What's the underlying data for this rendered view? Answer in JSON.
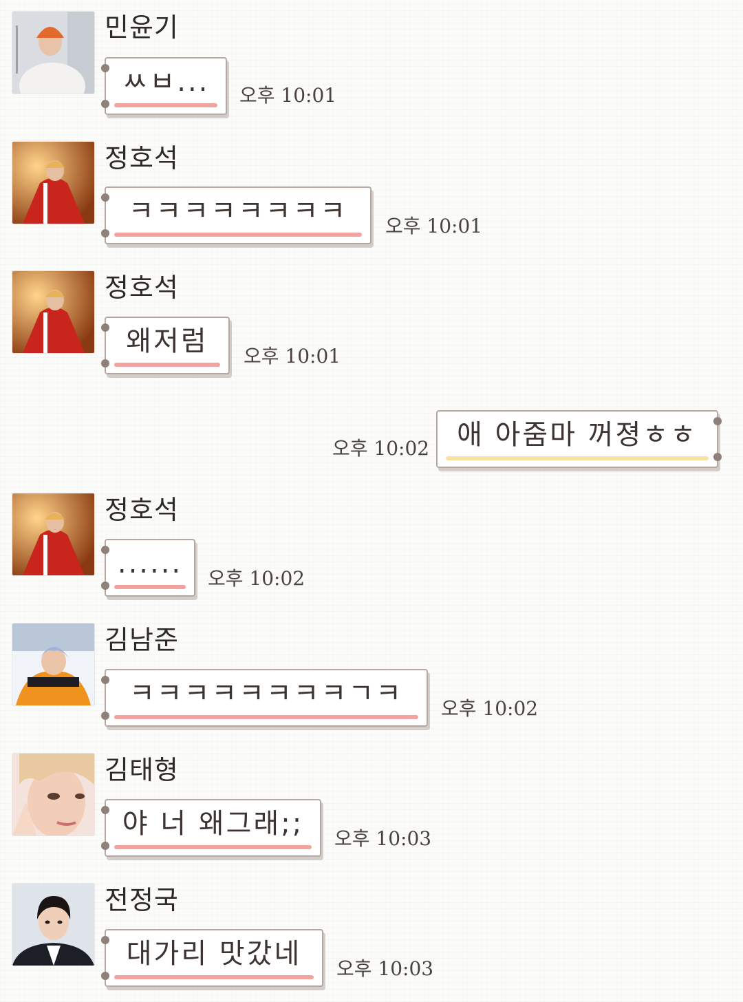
{
  "messages": [
    {
      "sender": "민윤기",
      "text": "ㅆㅂ...",
      "time": "오후 10:01"
    },
    {
      "sender": "정호석",
      "text": "ㅋㅋㅋㅋㅋㅋㅋㅋ",
      "time": "오후 10:01"
    },
    {
      "sender": "정호석",
      "text": "왜저럼",
      "time": "오후 10:01"
    },
    {
      "sender": "me",
      "text": "애 아줌마 꺼졍ㅎㅎ",
      "time": "오후 10:02"
    },
    {
      "sender": "정호석",
      "text": "......",
      "time": "오후 10:02"
    },
    {
      "sender": "김남준",
      "text": "ㅋㅋㅋㅋㅋㅋㅋㅋㄱㅋ",
      "time": "오후 10:02"
    },
    {
      "sender": "김태형",
      "text": "야 너 왜그래;;",
      "time": "오후 10:03"
    },
    {
      "sender": "전정국",
      "text": "대가리 맛갔네",
      "time": "오후 10:03"
    }
  ],
  "colors": {
    "underline_other": "#f2a3a0",
    "underline_mine": "#f9e2a1",
    "bubble_border": "#b5a8a0"
  }
}
